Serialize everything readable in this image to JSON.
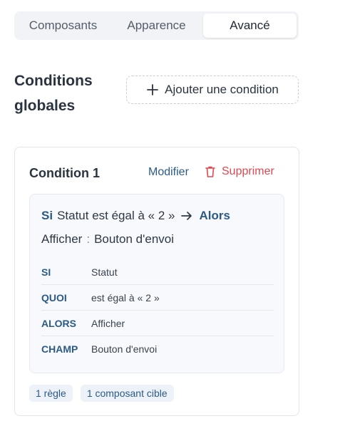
{
  "tabs": [
    {
      "label": "Composants",
      "active": false
    },
    {
      "label": "Apparence",
      "active": false
    },
    {
      "label": "Avancé",
      "active": true
    }
  ],
  "section": {
    "title": "Conditions globales",
    "add_button_label": "Ajouter une condition"
  },
  "condition": {
    "title": "Condition 1",
    "modify_label": "Modifier",
    "delete_label": "Supprimer",
    "summary": {
      "if_keyword": "Si",
      "if_text": "Statut est égal à « 2 »",
      "then_keyword": "Alors",
      "action": "Afficher",
      "separator": ":",
      "target": "Bouton d'envoi"
    },
    "rules": [
      {
        "key": "SI",
        "value": "Statut"
      },
      {
        "key": "QUOI",
        "value": "est égal à « 2 »"
      },
      {
        "key": "ALORS",
        "value": "Afficher"
      },
      {
        "key": "CHAMP",
        "value": "Bouton d'envoi"
      }
    ],
    "badges": [
      "1 règle",
      "1 composant cible"
    ]
  },
  "icons": {
    "add": "plus-icon",
    "delete": "trash-icon",
    "then": "arrow-right-icon"
  },
  "colors": {
    "accent_blue": "#2b5a86",
    "danger_red": "#e0484f",
    "text_dark": "#2a3440"
  }
}
